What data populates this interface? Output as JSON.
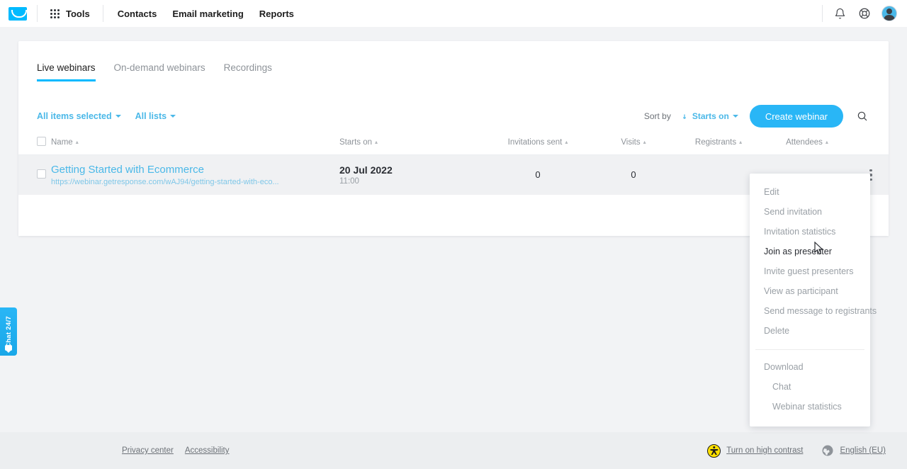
{
  "topnav": {
    "logo_name": "getresponse-logo",
    "tools_label": "Tools",
    "links": [
      {
        "label": "Contacts"
      },
      {
        "label": "Email marketing"
      },
      {
        "label": "Reports"
      }
    ],
    "notifications_icon": "bell-icon",
    "help_icon": "lifebuoy-icon",
    "avatar_name": "user-avatar"
  },
  "tabs": [
    {
      "label": "Live webinars",
      "active": true
    },
    {
      "label": "On-demand webinars",
      "active": false
    },
    {
      "label": "Recordings",
      "active": false
    }
  ],
  "toolbar": {
    "items_filter": "All items selected",
    "lists_filter": "All lists",
    "sort_by_label": "Sort by",
    "sort_value": "Starts on",
    "create_button": "Create webinar",
    "search_icon": "search-icon"
  },
  "table": {
    "columns": [
      {
        "label": "Name"
      },
      {
        "label": "Starts on"
      },
      {
        "label": "Invitations sent"
      },
      {
        "label": "Visits"
      },
      {
        "label": "Registrants"
      },
      {
        "label": "Attendees"
      }
    ],
    "rows": [
      {
        "title": "Getting Started with Ecommerce",
        "url": "https://webinar.getresponse.com/wAJ94/getting-started-with-eco...",
        "date": "20 Jul 2022",
        "time": "11:00",
        "invitations_sent": "0",
        "visits": "0",
        "registrants": "",
        "attendees": ""
      }
    ]
  },
  "context_menu": {
    "items": [
      {
        "label": "Edit",
        "hovered": false,
        "sub": false
      },
      {
        "label": "Send invitation",
        "hovered": false,
        "sub": false
      },
      {
        "label": "Invitation statistics",
        "hovered": false,
        "sub": false
      },
      {
        "label": "Join as presenter",
        "hovered": true,
        "sub": false
      },
      {
        "label": "Invite guest presenters",
        "hovered": false,
        "sub": false
      },
      {
        "label": "View as participant",
        "hovered": false,
        "sub": false
      },
      {
        "label": "Send message to registrants",
        "hovered": false,
        "sub": false
      },
      {
        "label": "Delete",
        "hovered": false,
        "sub": false
      }
    ],
    "download_label": "Download",
    "download_items": [
      {
        "label": "Chat"
      },
      {
        "label": "Webinar statistics"
      }
    ]
  },
  "chat_widget": {
    "label": "Chat 24/7"
  },
  "footer": {
    "privacy": "Privacy center",
    "accessibility": "Accessibility",
    "contrast": "Turn on high contrast",
    "language": "English (EU)"
  },
  "colors": {
    "accent": "#00baff",
    "link": "#4ab8e8",
    "button": "#29b6f6",
    "page_bg": "#f2f3f5"
  }
}
